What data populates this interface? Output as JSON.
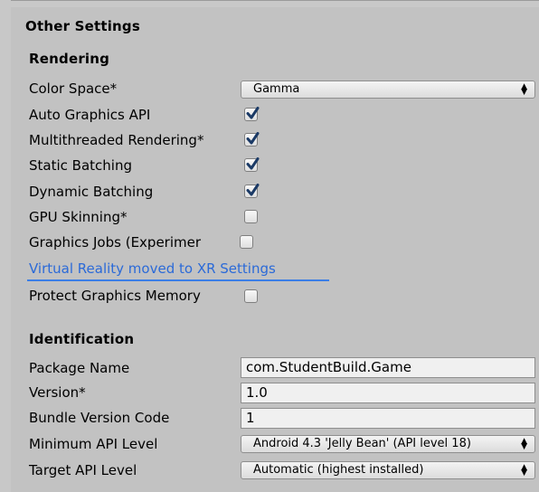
{
  "other_settings": {
    "title": "Other Settings"
  },
  "rendering": {
    "title": "Rendering",
    "color_space_label": "Color Space*",
    "color_space_value": "Gamma",
    "auto_graphics_api_label": "Auto Graphics API",
    "auto_graphics_api_checked": true,
    "multithreaded_label": "Multithreaded Rendering*",
    "multithreaded_checked": true,
    "static_batching_label": "Static Batching",
    "static_batching_checked": true,
    "dynamic_batching_label": "Dynamic Batching",
    "dynamic_batching_checked": true,
    "gpu_skinning_label": "GPU Skinning*",
    "gpu_skinning_checked": false,
    "graphics_jobs_label": "Graphics Jobs (Experimer",
    "graphics_jobs_checked": false,
    "vr_link": "Virtual Reality moved to XR Settings",
    "protect_memory_label": "Protect Graphics Memory",
    "protect_memory_checked": false
  },
  "identification": {
    "title": "Identification",
    "package_name_label": "Package Name",
    "package_name_value": "com.StudentBuild.Game",
    "version_label": "Version*",
    "version_value": "1.0",
    "bundle_version_label": "Bundle Version Code",
    "bundle_version_value": "1",
    "min_api_label": "Minimum API Level",
    "min_api_value": "Android 4.3 'Jelly Bean' (API level 18)",
    "target_api_label": "Target API Level",
    "target_api_value": "Automatic (highest installed)"
  },
  "icons": {
    "checkmark": "checkmark-icon",
    "dropdown_arrow": "dropdown-arrows-icon"
  },
  "colors": {
    "link": "#2b6ad8",
    "link_underline": "#3b7ee6",
    "checkmark": "#1b3a66"
  }
}
